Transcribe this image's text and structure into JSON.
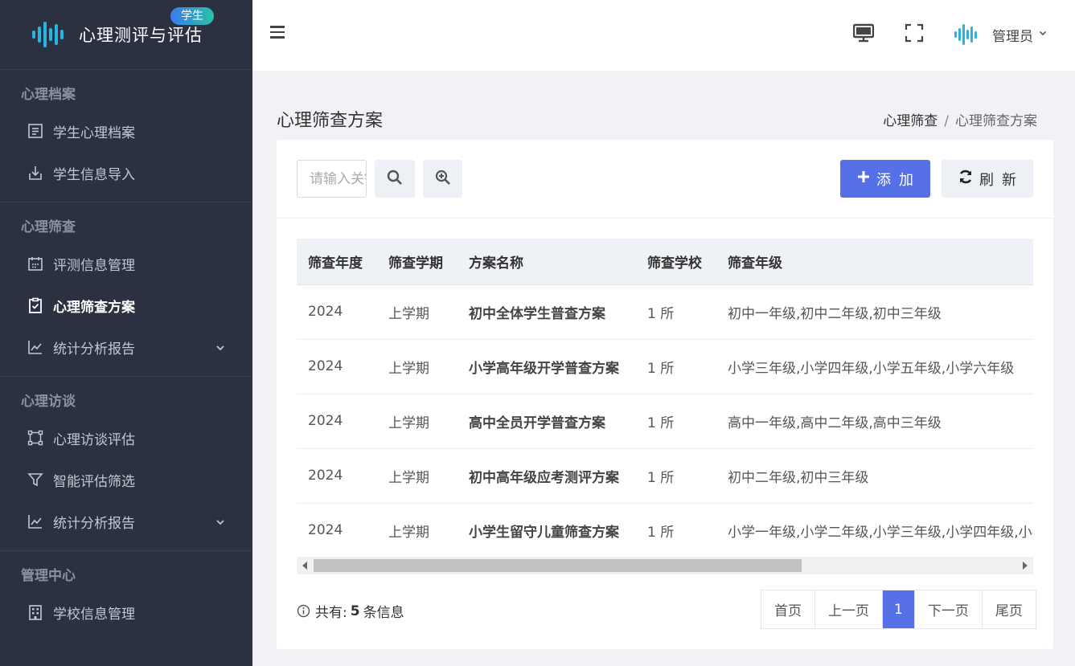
{
  "brand": {
    "title": "心理测评与评估",
    "badge": "学生",
    "accent": "#2bb3e0"
  },
  "sidebar": {
    "groups": [
      {
        "title": "心理档案",
        "items": [
          {
            "label": "学生心理档案",
            "icon": "file-text-icon"
          },
          {
            "label": "学生信息导入",
            "icon": "import-icon"
          }
        ]
      },
      {
        "title": "心理筛查",
        "items": [
          {
            "label": "评测信息管理",
            "icon": "calendar-icon"
          },
          {
            "label": "心理筛查方案",
            "icon": "clipboard-check-icon",
            "active": true
          },
          {
            "label": "统计分析报告",
            "icon": "line-chart-icon",
            "expandable": true
          }
        ]
      },
      {
        "title": "心理访谈",
        "items": [
          {
            "label": "心理访谈评估",
            "icon": "nodes-icon"
          },
          {
            "label": "智能评估筛选",
            "icon": "filter-icon"
          },
          {
            "label": "统计分析报告",
            "icon": "line-chart-icon",
            "expandable": true
          }
        ]
      },
      {
        "title": "管理中心",
        "items": [
          {
            "label": "学校信息管理",
            "icon": "building-icon"
          }
        ]
      }
    ]
  },
  "header": {
    "user_name": "管理员"
  },
  "page": {
    "title": "心理筛查方案",
    "breadcrumb": [
      "心理筛查",
      "心理筛查方案"
    ]
  },
  "toolbar": {
    "search_placeholder": "请输入关键字",
    "add_label": "添加",
    "refresh_label": "刷新",
    "primary_color": "#5670e8"
  },
  "table": {
    "columns": [
      "筛查年度",
      "筛查学期",
      "方案名称",
      "筛查学校",
      "筛查年级"
    ],
    "rows": [
      [
        "2024",
        "上学期",
        "初中全体学生普查方案",
        "1 所",
        "初中一年级,初中二年级,初中三年级"
      ],
      [
        "2024",
        "上学期",
        "小学高年级开学普查方案",
        "1 所",
        "小学三年级,小学四年级,小学五年级,小学六年级"
      ],
      [
        "2024",
        "上学期",
        "高中全员开学普查方案",
        "1 所",
        "高中一年级,高中二年级,高中三年级"
      ],
      [
        "2024",
        "上学期",
        "初中高年级应考测评方案",
        "1 所",
        "初中二年级,初中三年级"
      ],
      [
        "2024",
        "上学期",
        "小学生留守儿童筛查方案",
        "1 所",
        "小学一年级,小学二年级,小学三年级,小学四年级,小学"
      ]
    ]
  },
  "summary": {
    "prefix": "共有:",
    "count": "5",
    "suffix": "条信息"
  },
  "pagination": {
    "first": "首页",
    "prev": "上一页",
    "current": "1",
    "next": "下一页",
    "last": "尾页"
  }
}
